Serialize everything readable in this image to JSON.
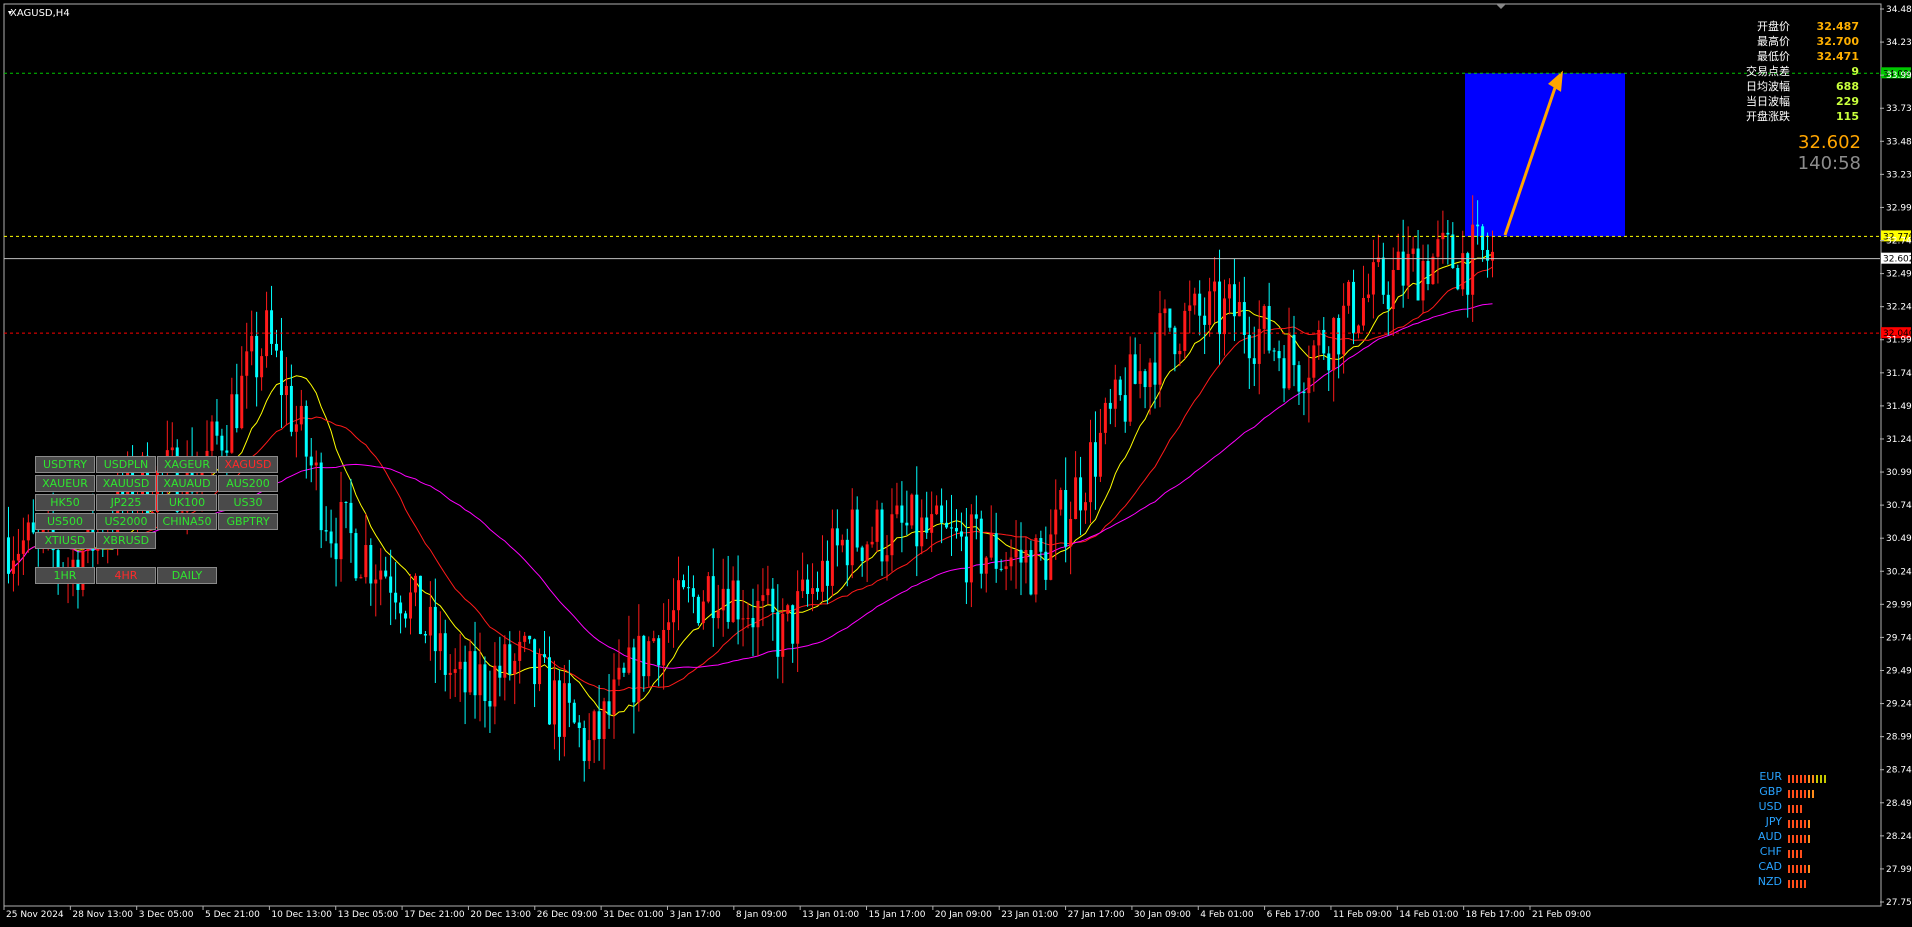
{
  "window": {
    "symbol_title": "XAGUSD,H4"
  },
  "chart_data": {
    "type": "candlestick",
    "symbol": "XAGUSD",
    "timeframe": "H4",
    "ylim": [
      27.75,
      34.485
    ],
    "y_ticks": [
      "34.485",
      "34.235",
      "33.990",
      "33.735",
      "33.485",
      "33.235",
      "32.990",
      "32.740",
      "32.490",
      "32.240",
      "31.990",
      "31.740",
      "31.490",
      "31.240",
      "30.990",
      "30.740",
      "30.490",
      "30.245",
      "29.995",
      "29.745",
      "29.495",
      "29.245",
      "28.995",
      "28.745",
      "28.495",
      "28.245",
      "27.995",
      "27.750"
    ],
    "x_ticks": [
      "25 Nov 2024",
      "28 Nov 13:00",
      "3 Dec 05:00",
      "5 Dec 21:00",
      "10 Dec 13:00",
      "13 Dec 05:00",
      "17 Dec 21:00",
      "20 Dec 13:00",
      "26 Dec 09:00",
      "31 Dec 01:00",
      "3 Jan 17:00",
      "8 Jan 09:00",
      "13 Jan 01:00",
      "15 Jan 17:00",
      "20 Jan 09:00",
      "23 Jan 01:00",
      "27 Jan 17:00",
      "30 Jan 09:00",
      "4 Feb 01:00",
      "6 Feb 17:00",
      "11 Feb 09:00",
      "14 Feb 01:00",
      "18 Feb 17:00",
      "21 Feb 09:00"
    ],
    "price_path": [
      {
        "x": "25 Nov 2024",
        "y": 30.5
      },
      {
        "x": "28 Nov 13:00",
        "y": 30.3
      },
      {
        "x": "3 Dec 05:00",
        "y": 30.9
      },
      {
        "x": "5 Dec 21:00",
        "y": 31.0
      },
      {
        "x": "10 Dec 13:00",
        "y": 32.0
      },
      {
        "x": "13 Dec 05:00",
        "y": 30.6
      },
      {
        "x": "17 Dec 21:00",
        "y": 30.2
      },
      {
        "x": "20 Dec 13:00",
        "y": 29.35
      },
      {
        "x": "26 Dec 09:00",
        "y": 29.55
      },
      {
        "x": "31 Dec 01:00",
        "y": 28.9
      },
      {
        "x": "3 Jan 17:00",
        "y": 29.75
      },
      {
        "x": "8 Jan 09:00",
        "y": 30.2
      },
      {
        "x": "13 Jan 01:00",
        "y": 29.75
      },
      {
        "x": "15 Jan 17:00",
        "y": 30.5
      },
      {
        "x": "20 Jan 09:00",
        "y": 30.55
      },
      {
        "x": "23 Jan 01:00",
        "y": 30.4
      },
      {
        "x": "27 Jan 17:00",
        "y": 30.3
      },
      {
        "x": "30 Jan 09:00",
        "y": 31.3
      },
      {
        "x": "4 Feb 01:00",
        "y": 32.1
      },
      {
        "x": "6 Feb 17:00",
        "y": 32.2
      },
      {
        "x": "11 Feb 09:00",
        "y": 31.8
      },
      {
        "x": "14 Feb 01:00",
        "y": 32.3
      },
      {
        "x": "18 Feb 17:00",
        "y": 32.6
      },
      {
        "x": "21 Feb 09:00",
        "y": 32.602
      }
    ],
    "series": [
      {
        "color": "#ffff00"
      },
      {
        "color": "#ff1a1a"
      },
      {
        "color": "#ff00ff"
      }
    ],
    "hlines": [
      {
        "price": 34.0,
        "label": "34.000",
        "color": "#00c800",
        "label_bg": "#00c800"
      },
      {
        "price": 32.77,
        "label": "32.770",
        "color": "#ffff00",
        "label_bg": "#ffff00"
      },
      {
        "price": 32.602,
        "label": "32.602",
        "color": "#c0c0c0",
        "label_bg": "#ffffff"
      },
      {
        "price": 32.04,
        "label": "32.040",
        "color": "#ff0000",
        "label_bg": "#ff0000"
      }
    ],
    "target_box": {
      "x_start": "20 Feb",
      "price_top": 34.0,
      "price_bottom": 32.77,
      "color": "#0000ff"
    },
    "candle_colors": {
      "up": "#ff1a1a",
      "down": "#00ffff"
    }
  },
  "symbol_buttons": [
    {
      "label": "USDTRY",
      "active": false
    },
    {
      "label": "USDPLN",
      "active": false
    },
    {
      "label": "XAGEUR",
      "active": false
    },
    {
      "label": "XAGUSD",
      "active": true
    },
    {
      "label": "XAUEUR",
      "active": false
    },
    {
      "label": "XAUUSD",
      "active": false
    },
    {
      "label": "XAUAUD",
      "active": false
    },
    {
      "label": "AUS200",
      "active": false
    },
    {
      "label": "HK50",
      "active": false
    },
    {
      "label": "JP225",
      "active": false
    },
    {
      "label": "UK100",
      "active": false
    },
    {
      "label": "US30",
      "active": false
    },
    {
      "label": "US500",
      "active": false
    },
    {
      "label": "US2000",
      "active": false
    },
    {
      "label": "CHINA50",
      "active": false
    },
    {
      "label": "GBPTRY",
      "active": false
    },
    {
      "label": "XTIUSD",
      "active": false
    },
    {
      "label": "XBRUSD",
      "active": false
    }
  ],
  "timeframe_buttons": [
    {
      "label": "1HR",
      "active": false
    },
    {
      "label": "4HR",
      "active": true
    },
    {
      "label": "DAILY",
      "active": false
    }
  ],
  "info_panel": {
    "rows": [
      {
        "label": "开盘价",
        "value": "32.487",
        "color": "#ffb000"
      },
      {
        "label": "最高价",
        "value": "32.700",
        "color": "#ffb000"
      },
      {
        "label": "最低价",
        "value": "32.471",
        "color": "#ffb000"
      },
      {
        "label": "交易点差",
        "value": "9",
        "color": "#c8ff3c"
      },
      {
        "label": "日均波幅",
        "value": "688",
        "color": "#c8ff3c"
      },
      {
        "label": "当日波幅",
        "value": "229",
        "color": "#c8ff3c"
      },
      {
        "label": "开盘涨跌",
        "value": "115",
        "color": "#c8ff3c"
      }
    ],
    "price": "32.602",
    "countdown": "140:58"
  },
  "currency_strength": [
    {
      "code": "EUR",
      "bars": 10
    },
    {
      "code": "GBP",
      "bars": 7
    },
    {
      "code": "USD",
      "bars": 4
    },
    {
      "code": "JPY",
      "bars": 6
    },
    {
      "code": "AUD",
      "bars": 6
    },
    {
      "code": "CHF",
      "bars": 4
    },
    {
      "code": "CAD",
      "bars": 6
    },
    {
      "code": "NZD",
      "bars": 5
    }
  ]
}
